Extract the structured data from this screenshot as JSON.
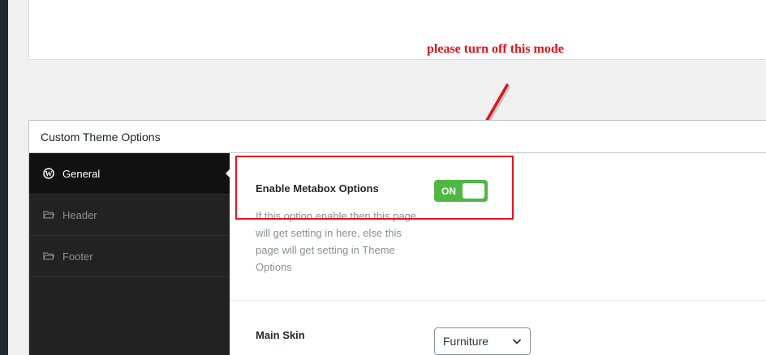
{
  "annotation": {
    "text": "please turn off this mode",
    "color": "#e0141e"
  },
  "metabox": {
    "title": "Custom Theme Options"
  },
  "tabs": [
    {
      "label": "General",
      "icon": "wordpress-icon",
      "active": true
    },
    {
      "label": "Header",
      "icon": "folder-icon",
      "active": false
    },
    {
      "label": "Footer",
      "icon": "folder-icon",
      "active": false
    }
  ],
  "fields": {
    "metabox_option": {
      "label": "Enable Metabox Options",
      "toggle_state": "ON",
      "description": "If this option enable then this page will get setting in here, else this page will get setting in Theme Options"
    },
    "main_skin": {
      "label": "Main Skin",
      "selected": "Furniture"
    }
  },
  "colors": {
    "toggle_on": "#4fb845",
    "sidebar_bg": "#222222",
    "sidebar_active_bg": "#111111"
  }
}
